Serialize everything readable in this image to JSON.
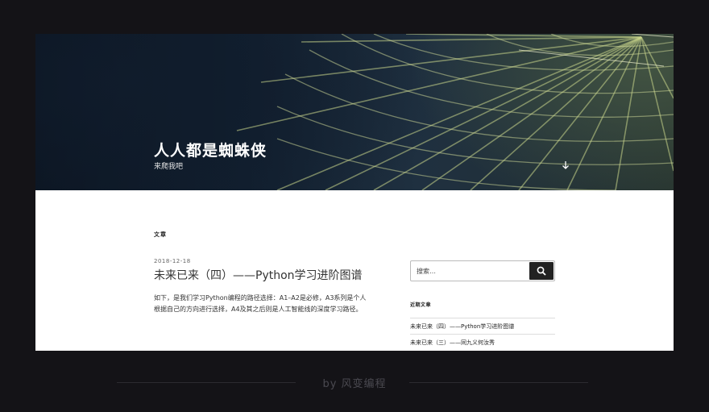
{
  "header": {
    "site_title": "人人都是蜘蛛侠",
    "site_description": "来爬我吧"
  },
  "main": {
    "section_label": "文章",
    "post": {
      "date": "2018-12-18",
      "title": "未来已来（四）——Python学习进阶图谱",
      "excerpt_line1": "如下，是我们学习Python编程的路径选择：A1–A2是必修，A3系列是个人",
      "excerpt_line2": "根据自己的方向进行选择，A4及其之后则是人工智能线的深度学习路径。"
    }
  },
  "sidebar": {
    "search": {
      "placeholder": "搜索…"
    },
    "recent_posts": {
      "title": "近期文章",
      "items": [
        "未来已来（四）——Python学习进阶图谱",
        "未来已来（三）——同九义何汝秀"
      ]
    }
  },
  "footer": {
    "credit": "by 风变编程"
  },
  "colors": {
    "page_bg": "#141317",
    "button_bg": "#222222",
    "title_text": "#ffffff"
  },
  "icons": {
    "search": "search-icon",
    "scroll": "arrow-down-icon"
  }
}
